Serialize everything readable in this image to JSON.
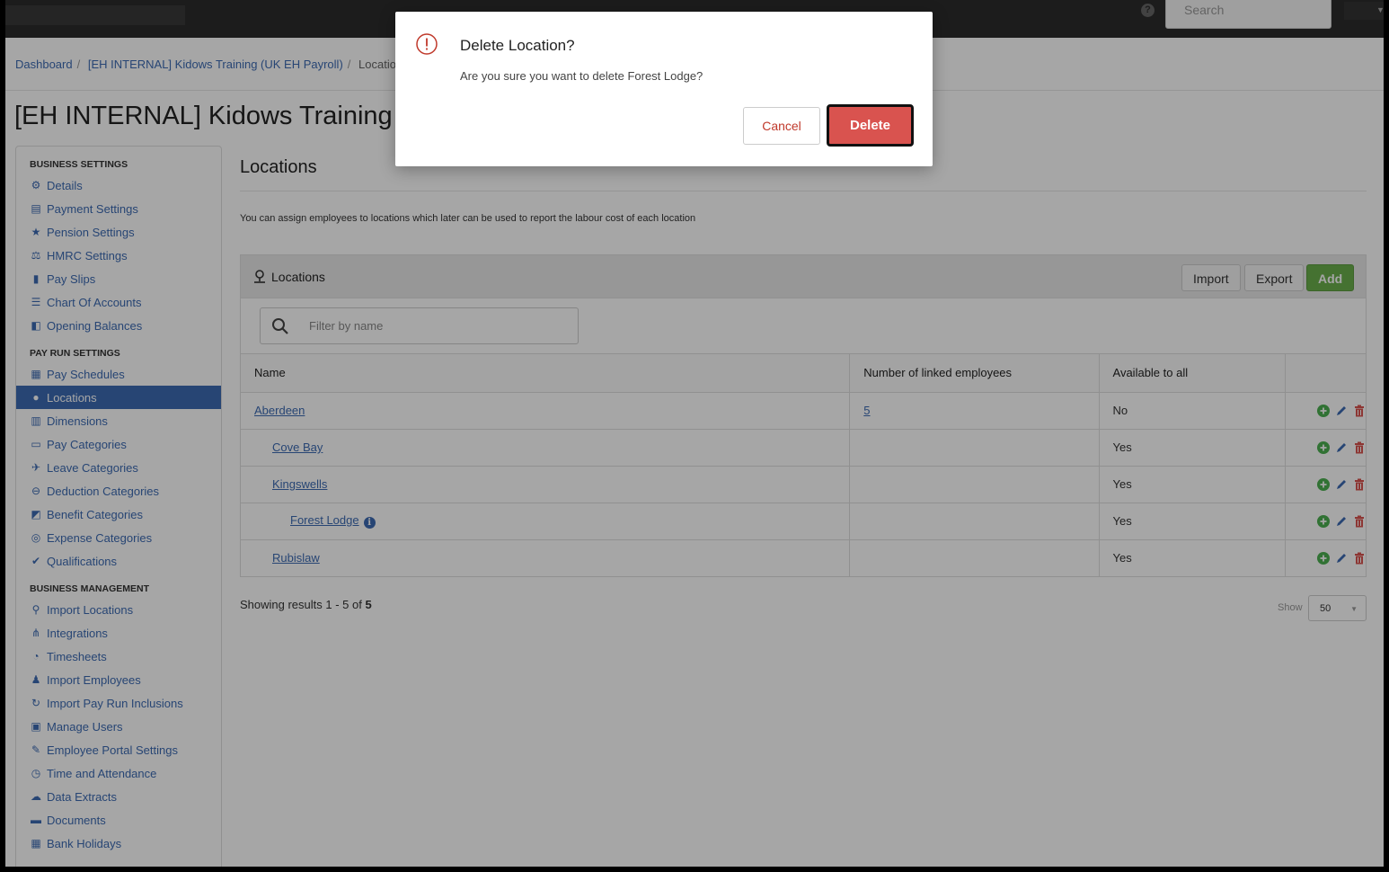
{
  "topbar": {
    "search_placeholder": "Search",
    "help_label": "?"
  },
  "breadcrumb": {
    "items": [
      "Dashboard",
      "[EH INTERNAL] Kidows Training (UK EH Payroll)",
      "Locations"
    ]
  },
  "page_title": "[EH INTERNAL] Kidows Training",
  "sidebar": {
    "sections": [
      {
        "title": "BUSINESS SETTINGS",
        "items": [
          {
            "label": "Details",
            "icon": "gear-icon"
          },
          {
            "label": "Payment Settings",
            "icon": "payment-icon"
          },
          {
            "label": "Pension Settings",
            "icon": "star-icon"
          },
          {
            "label": "HMRC Settings",
            "icon": "scales-icon"
          },
          {
            "label": "Pay Slips",
            "icon": "file-icon"
          },
          {
            "label": "Chart Of Accounts",
            "icon": "list-icon"
          },
          {
            "label": "Opening Balances",
            "icon": "balance-icon"
          }
        ]
      },
      {
        "title": "PAY RUN SETTINGS",
        "items": [
          {
            "label": "Pay Schedules",
            "icon": "calendar-icon"
          },
          {
            "label": "Locations",
            "icon": "globe-icon",
            "active": true
          },
          {
            "label": "Dimensions",
            "icon": "chart-icon"
          },
          {
            "label": "Pay Categories",
            "icon": "money-icon"
          },
          {
            "label": "Leave Categories",
            "icon": "plane-icon"
          },
          {
            "label": "Deduction Categories",
            "icon": "minus-circle-icon"
          },
          {
            "label": "Benefit Categories",
            "icon": "benefit-icon"
          },
          {
            "label": "Expense Categories",
            "icon": "expense-icon"
          },
          {
            "label": "Qualifications",
            "icon": "check-icon"
          }
        ]
      },
      {
        "title": "BUSINESS MANAGEMENT",
        "items": [
          {
            "label": "Import Locations",
            "icon": "location-pin-icon"
          },
          {
            "label": "Integrations",
            "icon": "integrations-icon"
          },
          {
            "label": "Timesheets",
            "icon": "clock-icon"
          },
          {
            "label": "Import Employees",
            "icon": "users-icon"
          },
          {
            "label": "Import Pay Run Inclusions",
            "icon": "refresh-icon"
          },
          {
            "label": "Manage Users",
            "icon": "lock-icon"
          },
          {
            "label": "Employee Portal Settings",
            "icon": "wand-icon"
          },
          {
            "label": "Time and Attendance",
            "icon": "time-icon"
          },
          {
            "label": "Data Extracts",
            "icon": "cloud-download-icon"
          },
          {
            "label": "Documents",
            "icon": "folder-icon"
          },
          {
            "label": "Bank Holidays",
            "icon": "calendar-icon"
          }
        ]
      }
    ]
  },
  "main": {
    "heading": "Locations",
    "description": "You can assign employees to locations which later can be used to report the labour cost of each location",
    "panel_title": "Locations",
    "import_label": "Import",
    "export_label": "Export",
    "add_label": "Add",
    "filter_placeholder": "Filter by name",
    "columns": [
      "Name",
      "Number of linked employees",
      "Available to all"
    ],
    "rows": [
      {
        "name": "Aberdeen",
        "level": 0,
        "employees": "5",
        "available": "No"
      },
      {
        "name": "Cove Bay",
        "level": 1,
        "employees": "",
        "available": "Yes"
      },
      {
        "name": "Kingswells",
        "level": 1,
        "employees": "",
        "available": "Yes"
      },
      {
        "name": "Forest Lodge",
        "level": 2,
        "employees": "",
        "available": "Yes",
        "info": true
      },
      {
        "name": "Rubislaw",
        "level": 1,
        "employees": "",
        "available": "Yes"
      }
    ],
    "results_prefix": "Showing results 1 - 5 of ",
    "results_total": "5",
    "show_label": "Show",
    "page_size": "50"
  },
  "modal": {
    "title": "Delete Location?",
    "message": "Are you sure you want to delete Forest Lodge?",
    "cancel_label": "Cancel",
    "delete_label": "Delete"
  },
  "colors": {
    "accent": "#3d6bb3",
    "danger": "#d9534f",
    "success": "#6ab04c"
  }
}
